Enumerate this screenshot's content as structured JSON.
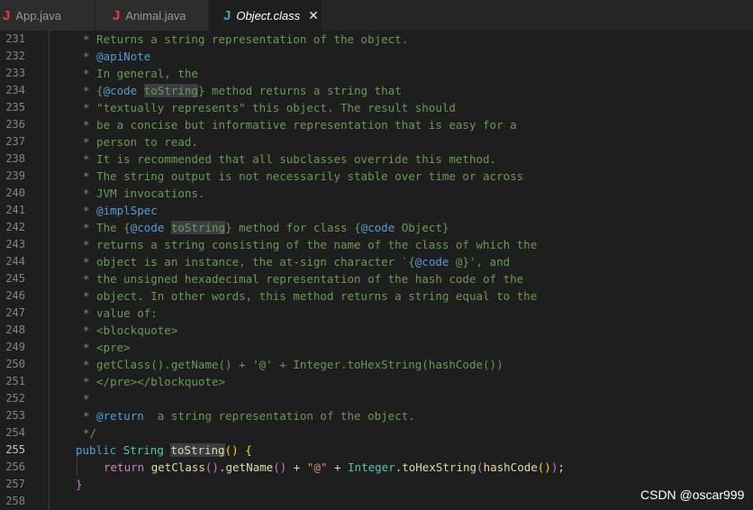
{
  "tabs": [
    {
      "label": "App.java",
      "icon": "J",
      "active": false
    },
    {
      "label": "Animal.java",
      "icon": "J",
      "active": false
    },
    {
      "label": "Object.class",
      "icon": "J",
      "active": true,
      "close": "✕"
    }
  ],
  "colors": {
    "editor_bg": "#1e1e1e",
    "comment": "#6a9955",
    "keyword": "#569cd6",
    "type": "#4ec9b0",
    "function": "#dcdcaa",
    "string": "#ce9178"
  },
  "line_numbers": [
    "231",
    "232",
    "233",
    "234",
    "235",
    "236",
    "237",
    "238",
    "239",
    "240",
    "241",
    "242",
    "243",
    "244",
    "245",
    "246",
    "247",
    "248",
    "249",
    "250",
    "251",
    "252",
    "253",
    "254",
    "255",
    "256",
    "257",
    "258"
  ],
  "active_line": "255",
  "code": {
    "l231": "* Returns a string representation of the object.",
    "l232": "* ",
    "l232_tag": "@apiNote",
    "l233": "* In general, the",
    "l234_a": "* {",
    "l234_tag": "@code",
    "l234_sp": " ",
    "l234_hl": "toString",
    "l234_b": "} method returns a string that",
    "l235": "* \"textually represents\" this object. The result should",
    "l236": "* be a concise but informative representation that is easy for a",
    "l237": "* person to read.",
    "l238": "* It is recommended that all subclasses override this method.",
    "l239": "* The string output is not necessarily stable over time or across",
    "l240": "* JVM invocations.",
    "l241": "* ",
    "l241_tag": "@implSpec",
    "l242_a": "* The {",
    "l242_tag1": "@code",
    "l242_sp": " ",
    "l242_hl": "toString",
    "l242_b": "} method for class {",
    "l242_tag2": "@code",
    "l242_c": " Object}",
    "l243": "* returns a string consisting of the name of the class of which the",
    "l244_a": "* object is an instance, the at-sign character `{",
    "l244_tag": "@code",
    "l244_b": " @}', and",
    "l245": "* the unsigned hexadecimal representation of the hash code of the",
    "l246": "* object. In other words, this method returns a string equal to the",
    "l247": "* value of:",
    "l248": "* <blockquote>",
    "l249": "* <pre>",
    "l250": "* getClass().getName() + '@' + Integer.toHexString(hashCode())",
    "l251": "* </pre></blockquote>",
    "l252": "*",
    "l253_a": "* ",
    "l253_tag": "@return",
    "l253_b": "  a string representation of the object.",
    "l254": "*/",
    "l255_public": "public",
    "l255_type": "String",
    "l255_name": "toString",
    "l255_paren": "()",
    "l255_brace": "{",
    "l256_return": "return",
    "l256_getClass": "getClass",
    "l256_p1": "()",
    "l256_getName": "getName",
    "l256_p2": "()",
    "l256_plus": "+",
    "l256_str": "\"@\"",
    "l256_Integer": "Integer",
    "l256_hex": "toHexString",
    "l256_hashCode": "hashCode",
    "l256_end": ";",
    "l257": "}"
  },
  "watermark": "CSDN @oscar999"
}
